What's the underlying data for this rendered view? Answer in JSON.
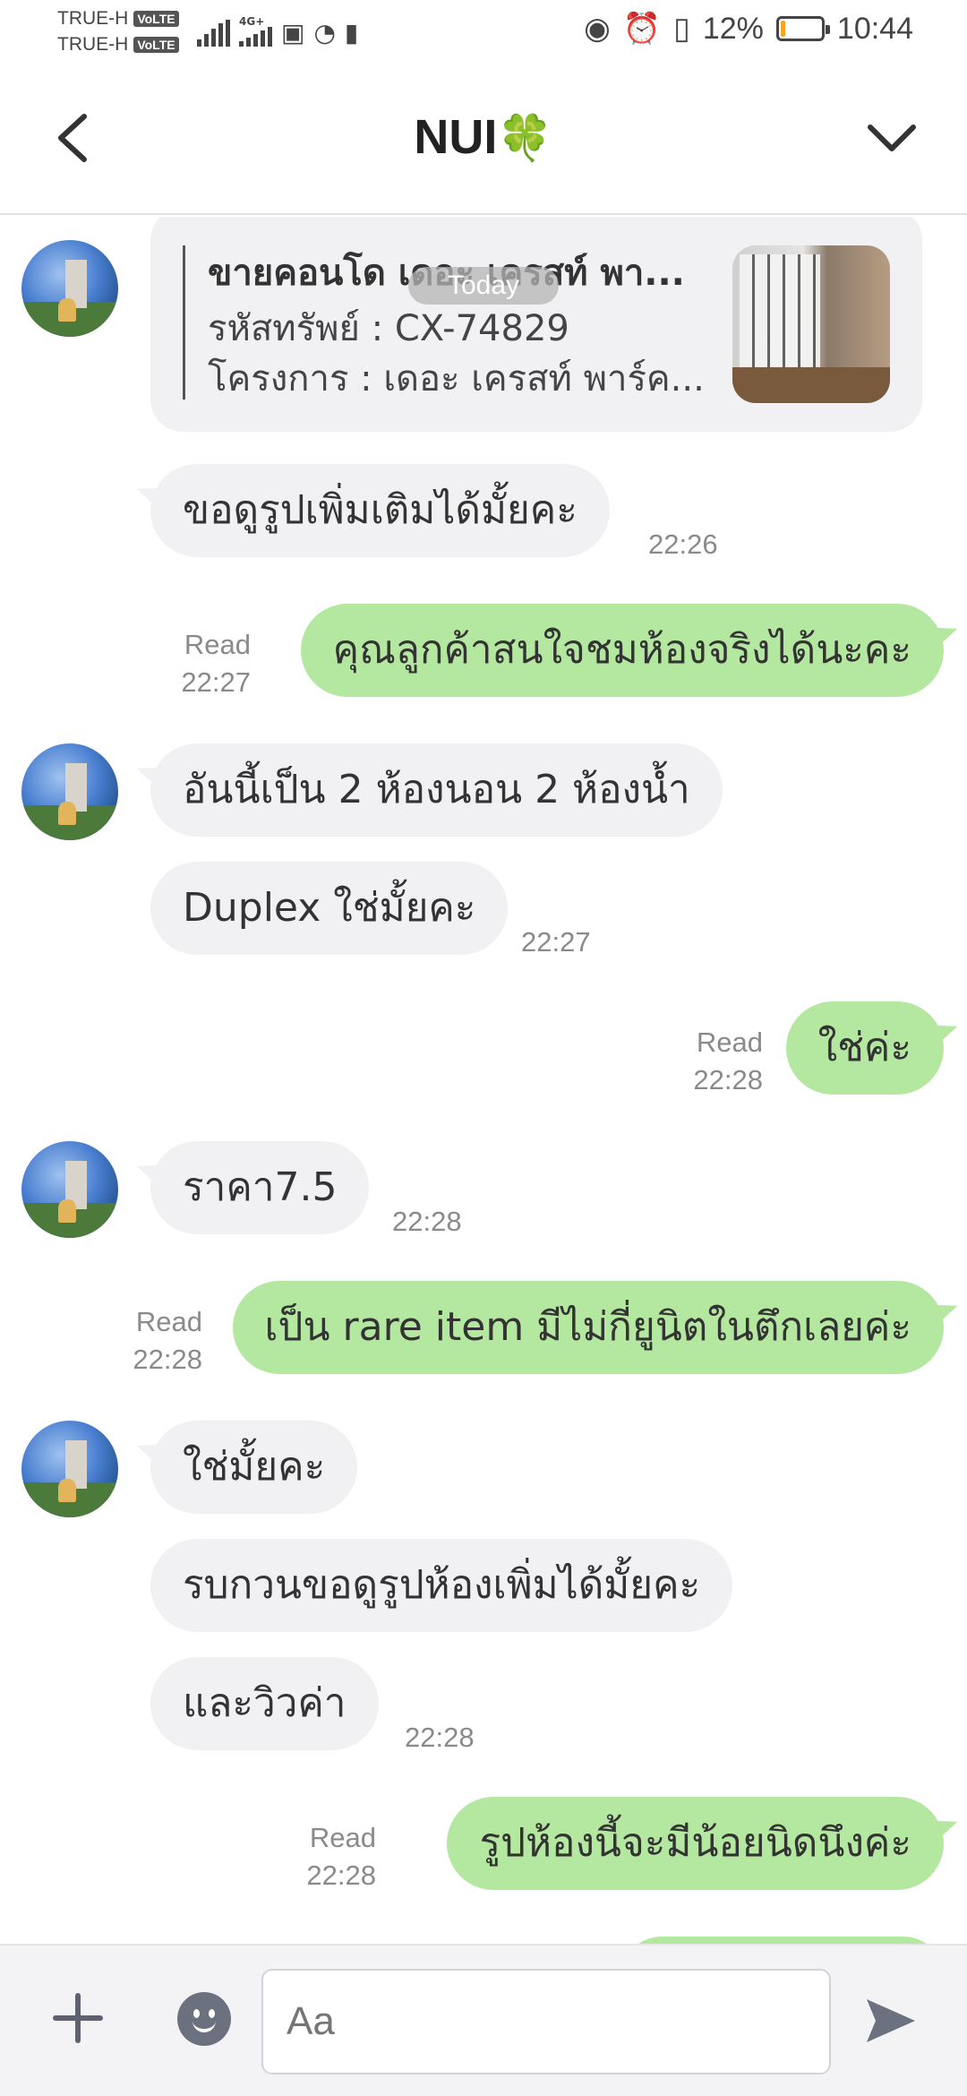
{
  "status_bar": {
    "carrier_1": "TRUE-H",
    "carrier_2": "TRUE-H",
    "volte": "VoLTE",
    "network": "4G+",
    "battery": "12%",
    "battery_level": 0.12,
    "time": "10:44"
  },
  "header": {
    "title": "NUI",
    "title_emoji": "🍀",
    "back_icon": "back-chevron-icon",
    "expand_icon": "chevron-down-icon"
  },
  "date_divider": "Today",
  "card": {
    "title": "ขายคอนโด เดอะ เครสท์ พา...",
    "line1": "รหัสทรัพย์ : CX-74829",
    "line2": "โครงการ : เดอะ เครสท์ พาร์ค..."
  },
  "messages": [
    {
      "side": "in",
      "text": "ขอดูรูปเพิ่มเติมได้มั้ยคะ",
      "time": "22:26"
    },
    {
      "side": "out",
      "text": "คุณลูกค้าสนใจชมห้องจริงได้นะคะ",
      "status": "Read",
      "time": "22:27"
    },
    {
      "side": "in",
      "text": "อันนี้เป็น 2 ห้องนอน 2 ห้องน้ำ"
    },
    {
      "side": "in",
      "text": "Duplex ใช่มั้ยคะ",
      "time": "22:27"
    },
    {
      "side": "out",
      "text": "ใช่ค่ะ",
      "status": "Read",
      "time": "22:28"
    },
    {
      "side": "in",
      "text": "ราคา7.5",
      "time": "22:28"
    },
    {
      "side": "out",
      "text": "เป็น rare item มีไม่กี่ยูนิตในตึกเลยค่ะ",
      "status": "Read",
      "time": "22:28"
    },
    {
      "side": "in",
      "text": "ใช่มั้ยคะ"
    },
    {
      "side": "in",
      "text": "รบกวนขอดูรูปห้องเพิ่มได้มั้ยคะ"
    },
    {
      "side": "in",
      "text": "และวิวค่า",
      "time": "22:28"
    },
    {
      "side": "out",
      "text": "รูปห้องนี้จะมีน้อยนิดนึงค่ะ",
      "status": "Read",
      "time": "22:28"
    }
  ],
  "input": {
    "placeholder": "Aa",
    "add_icon": "plus-icon",
    "emoji_icon": "emoji-icon",
    "send_icon": "send-icon"
  },
  "colors": {
    "incoming_bubble": "#f1f1f3",
    "outgoing_bubble": "#b4e8a1",
    "battery_low": "#f5a623"
  }
}
